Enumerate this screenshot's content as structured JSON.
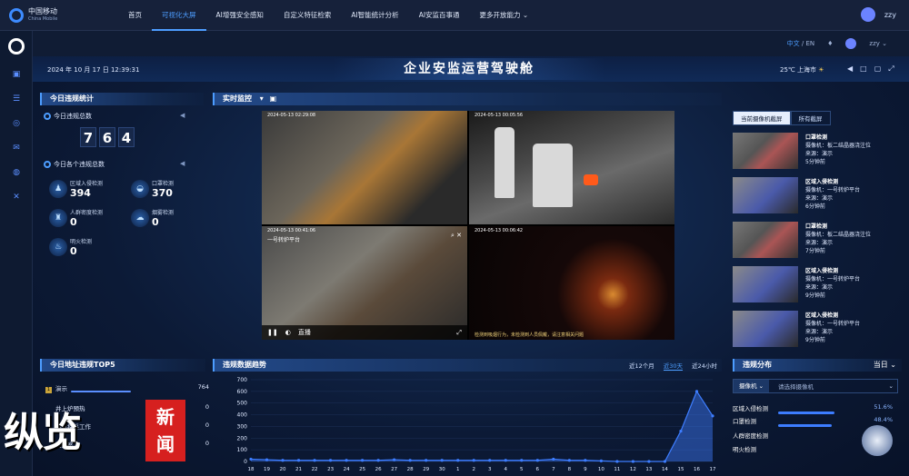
{
  "topnav": {
    "logo_cn": "中国移动",
    "logo_en": "China Mobile",
    "items": [
      "首页",
      "可视化大屏",
      "AI增强安全感知",
      "自定义特征检索",
      "AI智能统计分析",
      "AI安监百事通",
      "更多开放能力 ⌄"
    ],
    "user": "zzy"
  },
  "langbar": {
    "zh": "中文",
    "sep": " / ",
    "en": "EN",
    "user": "zzy ⌄"
  },
  "header": {
    "datetime": "2024 年 10 月 17 日 12:39:31",
    "title": "企业安监运营驾驶舱",
    "weather": "25℃  上海市"
  },
  "left": {
    "title": "今日违规统计",
    "total_label": "今日违规总数",
    "total_digits": [
      "7",
      "6",
      "4"
    ],
    "each_label": "今日各个违规总数",
    "items": [
      {
        "label": "区域入侵检测",
        "value": "394",
        "icon": "person-icon"
      },
      {
        "label": "口罩检测",
        "value": "370",
        "icon": "mask-icon"
      },
      {
        "label": "人群密度检测",
        "value": "0",
        "icon": "crowd-icon"
      },
      {
        "label": "烟雾检测",
        "value": "0",
        "icon": "smoke-icon"
      },
      {
        "label": "明火检测",
        "value": "0",
        "icon": "fire-icon"
      }
    ]
  },
  "monitor": {
    "title": "实时监控",
    "timestamps": [
      "2024-05-13 02:29:08",
      "2024-05-13 00:05:56",
      "2024-05-13 00:41:06",
      "2024-05-13 00:06:42"
    ],
    "cam3_label": "一号转炉平台",
    "live": "直播",
    "cam4_caption": "检测到吸烟行为，未检测到人员佩戴，请注意相关问题"
  },
  "snapshots": {
    "tabs": [
      "当前摄像机截屏",
      "所有截屏"
    ],
    "items": [
      {
        "title": "口罩检测",
        "camera": "摄像机：板二结晶器浇注位",
        "source": "来源：演示",
        "time": "5分钟前",
        "style": "a"
      },
      {
        "title": "区域入侵检测",
        "camera": "摄像机：一号转炉平台",
        "source": "来源：演示",
        "time": "6分钟前",
        "style": "b"
      },
      {
        "title": "口罩检测",
        "camera": "摄像机：板二结晶器浇注位",
        "source": "来源：演示",
        "time": "7分钟前",
        "style": "a"
      },
      {
        "title": "区域入侵检测",
        "camera": "摄像机：一号转炉平台",
        "source": "来源：演示",
        "time": "9分钟前",
        "style": "b"
      },
      {
        "title": "区域入侵检测",
        "camera": "摄像机：一号转炉平台",
        "source": "来源：演示",
        "time": "9分钟前",
        "style": "b"
      }
    ]
  },
  "top5": {
    "title": "今日地址违规TOP5",
    "items": [
      {
        "label": "演示",
        "value": "764",
        "frac": 1.0
      },
      {
        "label": "井上炉预热",
        "value": "0",
        "frac": 0
      },
      {
        "label": "井下探采工作",
        "value": "0",
        "frac": 0
      },
      {
        "label": "监控室",
        "value": "0",
        "frac": 0
      }
    ]
  },
  "trend": {
    "title": "违规数据趋势",
    "ranges": [
      "近12个月",
      "近30天",
      "近24小时"
    ],
    "active_range": "近30天"
  },
  "chart_data": {
    "type": "area",
    "x": [
      "18",
      "19",
      "20",
      "21",
      "22",
      "23",
      "24",
      "25",
      "26",
      "27",
      "28",
      "29",
      "30",
      "1",
      "2",
      "3",
      "4",
      "5",
      "6",
      "7",
      "8",
      "9",
      "10",
      "11",
      "12",
      "13",
      "14",
      "15",
      "16",
      "17"
    ],
    "values": [
      20,
      15,
      10,
      10,
      10,
      10,
      10,
      10,
      10,
      15,
      10,
      10,
      10,
      10,
      10,
      10,
      10,
      10,
      10,
      20,
      10,
      10,
      5,
      0,
      0,
      0,
      0,
      260,
      600,
      390
    ],
    "ylim": [
      0,
      700
    ],
    "yticks": [
      "700",
      "600",
      "500",
      "400",
      "300",
      "200",
      "100",
      "0"
    ],
    "color": "#3d7dff"
  },
  "dist": {
    "title": "违规分布",
    "period": "当日 ⌄",
    "selector_key": "摄像机 ⌄",
    "selector_placeholder": "请选择摄像机",
    "items": [
      {
        "label": "区域入侵检测",
        "pct": "51.6%",
        "frac": 0.516
      },
      {
        "label": "口罩检测",
        "pct": "48.4%",
        "frac": 0.484
      },
      {
        "label": "人群密度检测",
        "pct": "",
        "frac": 0
      },
      {
        "label": "明火检测",
        "pct": "",
        "frac": 0
      }
    ]
  },
  "watermark": {
    "text": "纵览",
    "box_line1": "新",
    "box_line2": "闻"
  }
}
